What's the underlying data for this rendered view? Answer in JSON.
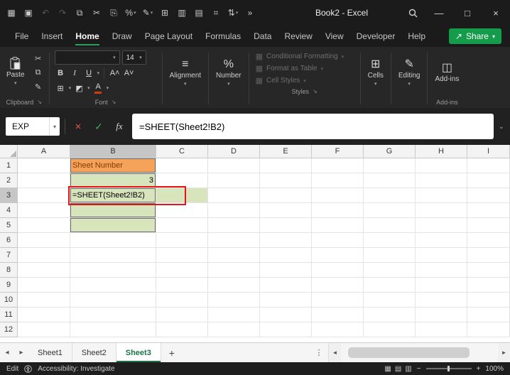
{
  "colors": {
    "accent_green": "#2E9E5B",
    "share_green": "#159C4B",
    "orange_fill": "#F5A25A",
    "orange_text": "#833C00",
    "green_fill": "#D8E4BC",
    "red_border": "#E51515"
  },
  "icons": {
    "dropdown": "▾",
    "chevron_down": "⌄",
    "launcher": "↘",
    "cut": "✂",
    "copy": "⧉",
    "format_painter": "✎",
    "borders": "⊞",
    "fill_color": "◩",
    "font_color_letter": "A",
    "grow_font": "A˄",
    "shrink_font": "A˅",
    "align": "≡",
    "percent": "%",
    "cells_icon": "⊞",
    "editing_icon": "✎",
    "addins_icon": "◫",
    "style_square": "▦",
    "share_arrow": "↗",
    "sheet_nav_left": "◂",
    "sheet_nav_right": "▸",
    "add_sheet": "+",
    "tab_menu": "⋮",
    "scroll_left": "◄",
    "scroll_right": "►"
  },
  "titlebar": {
    "title": "Book2  -  Excel",
    "icons": [
      {
        "name": "quick-access-grid-icon",
        "glyph": "▦"
      },
      {
        "name": "save-icon",
        "glyph": "▣"
      },
      {
        "name": "undo-icon",
        "glyph": "↶",
        "disabled": true
      },
      {
        "name": "redo-icon",
        "glyph": "↷",
        "disabled": true
      },
      {
        "name": "copy-book-icon",
        "glyph": "⧉"
      },
      {
        "name": "cut-icon",
        "glyph": "✂"
      },
      {
        "name": "paste-special-icon",
        "glyph": "⎘"
      },
      {
        "name": "percent-style-icon",
        "glyph": "%",
        "dropdown": true
      },
      {
        "name": "format-painter-icon",
        "glyph": "✎",
        "dropdown": true
      },
      {
        "name": "borders-icon",
        "glyph": "⊞"
      },
      {
        "name": "merge-cells-icon",
        "glyph": "▥"
      },
      {
        "name": "camera-icon",
        "glyph": "▤"
      },
      {
        "name": "freeze-panes-icon",
        "glyph": "⌗"
      },
      {
        "name": "sort-filter-icon",
        "glyph": "⇅",
        "dropdown": true
      },
      {
        "name": "more-commands-icon",
        "glyph": "»"
      }
    ],
    "window_controls": {
      "minimize": "—",
      "maximize": "□",
      "close": "×"
    }
  },
  "menubar": {
    "tabs": [
      {
        "label": "File"
      },
      {
        "label": "Insert"
      },
      {
        "label": "Home",
        "active": true
      },
      {
        "label": "Draw"
      },
      {
        "label": "Page Layout"
      },
      {
        "label": "Formulas"
      },
      {
        "label": "Data"
      },
      {
        "label": "Review"
      },
      {
        "label": "View"
      },
      {
        "label": "Developer"
      },
      {
        "label": "Help"
      }
    ],
    "share_label": "Share"
  },
  "ribbon": {
    "clipboard": {
      "paste_label": "Paste",
      "group_label": "Clipboard"
    },
    "font": {
      "group_label": "Font",
      "name_value": "",
      "size_value": "14",
      "bold": "B",
      "italic": "I",
      "underline": "U"
    },
    "alignment": {
      "label": "Alignment"
    },
    "number": {
      "label": "Number"
    },
    "styles": {
      "group_label": "Styles",
      "items": [
        {
          "label": "Conditional Formatting"
        },
        {
          "label": "Format as Table"
        },
        {
          "label": "Cell Styles"
        }
      ]
    },
    "cells": {
      "label": "Cells"
    },
    "editing": {
      "label": "Editing"
    },
    "addins": {
      "label": "Add-ins",
      "group_label": "Add-ins"
    }
  },
  "formula_bar": {
    "name_box_value": "EXP",
    "cancel_glyph": "×",
    "enter_glyph": "✓",
    "fx_label": "fx",
    "formula": "=SHEET(Sheet2!B2)"
  },
  "grid": {
    "columns": [
      "A",
      "B",
      "C",
      "D",
      "E",
      "F",
      "G",
      "H",
      "I"
    ],
    "row_count": 12,
    "selected_column": "B",
    "selected_row": "3",
    "cells": [
      {
        "ref": "B1",
        "text": "Sheet Number",
        "fill": "orange",
        "text_color": "#833C00",
        "align": "left",
        "boxed": true
      },
      {
        "ref": "B2",
        "text": "3",
        "fill": "green",
        "align": "right",
        "boxed": true
      },
      {
        "ref": "B3",
        "text": "=SHEET(Sheet2!B2)",
        "fill": "green",
        "align": "left",
        "boxed": true
      },
      {
        "ref": "B4",
        "fill": "green",
        "boxed": true
      },
      {
        "ref": "B5",
        "fill": "green",
        "boxed": true
      },
      {
        "ref": "C3",
        "fill": "green"
      }
    ]
  },
  "sheet_bar": {
    "tabs": [
      {
        "label": "Sheet1"
      },
      {
        "label": "Sheet2"
      },
      {
        "label": "Sheet3",
        "active": true
      }
    ]
  },
  "status_bar": {
    "mode": "Edit",
    "accessibility": "Accessibility: Investigate",
    "views": [
      {
        "name": "normal-view-icon",
        "glyph": "▦"
      },
      {
        "name": "page-layout-view-icon",
        "glyph": "▤"
      },
      {
        "name": "page-break-view-icon",
        "glyph": "▥"
      }
    ],
    "zoom_out": "−",
    "zoom_in": "+",
    "zoom_level": "100%"
  }
}
